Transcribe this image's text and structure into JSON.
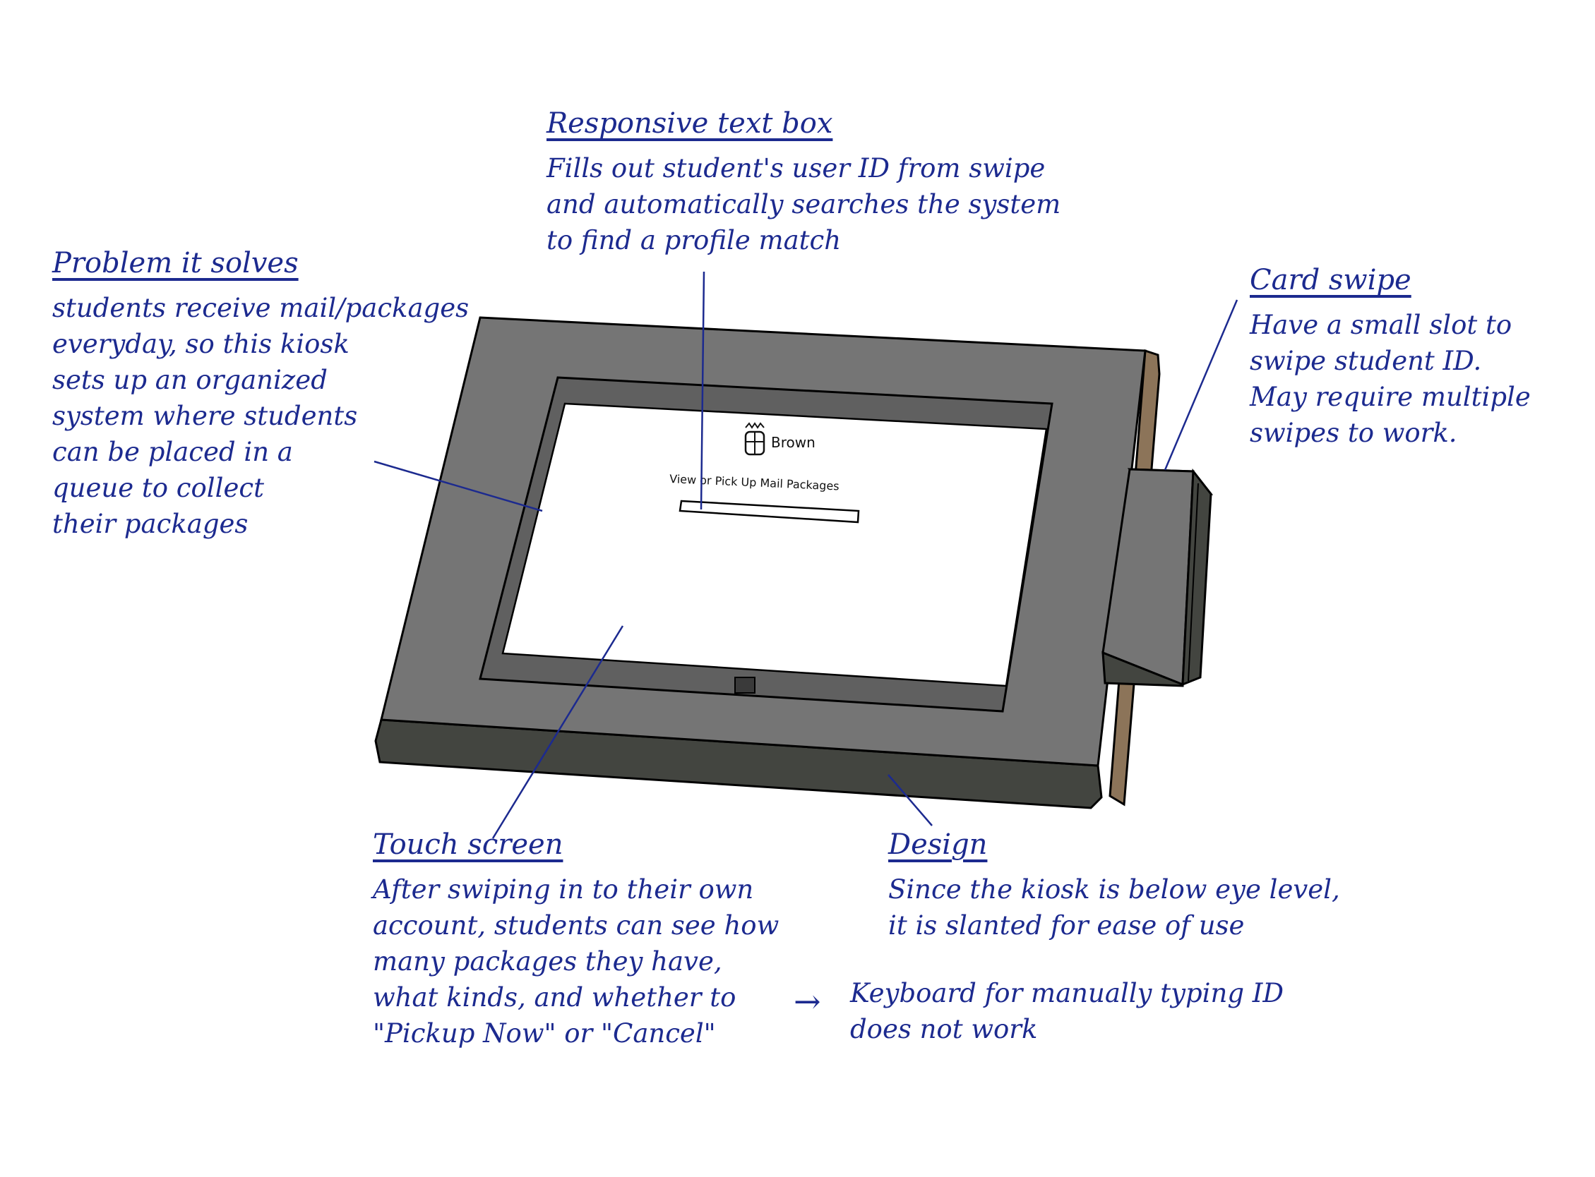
{
  "annotations": {
    "responsive_text_box": {
      "title": "Responsive text box",
      "lines": [
        "Fills out student's user ID from swipe",
        "and automatically searches the system",
        "to find a profile match"
      ]
    },
    "problem": {
      "title": "Problem it solves",
      "lines": [
        "students receive mail/packages",
        "everyday, so this kiosk",
        "sets up an organized",
        "system where students",
        "can be placed in a",
        "queue to collect",
        "their packages"
      ]
    },
    "card_swipe": {
      "title": "Card swipe",
      "lines": [
        "Have a small slot to",
        "swipe student ID.",
        "May require multiple",
        "swipes to work."
      ]
    },
    "touch_screen": {
      "title": "Touch screen",
      "lines": [
        "After swiping in to their own",
        "account, students can see how",
        "many packages they have,",
        "what kinds, and whether to",
        "\"Pickup Now\" or \"Cancel\""
      ]
    },
    "design": {
      "title": "Design",
      "lines": [
        "Since the kiosk is below eye level,",
        "it is slanted for ease of use"
      ]
    },
    "keyboard": {
      "arrow": "→",
      "lines": [
        "Keyboard for manually typing ID",
        "does not work"
      ]
    }
  },
  "kiosk_screen": {
    "brand": "Brown",
    "heading": "View or Pick Up Mail Packages",
    "logo_icon": "brown-shield-icon"
  },
  "colors": {
    "ink": "#1c2a8f",
    "frame_top": "#757575",
    "frame_side": "#434540",
    "wood": "#8c7459"
  }
}
